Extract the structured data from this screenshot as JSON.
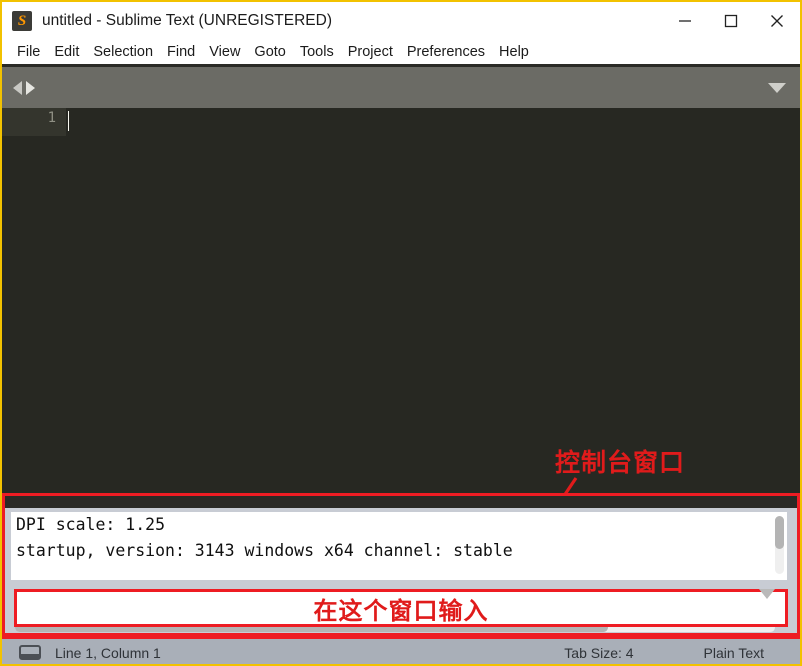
{
  "window": {
    "title": "untitled - Sublime Text (UNREGISTERED)",
    "icon": "sublime-text-icon",
    "icon_glyph": "S",
    "border_color": "#f2c200",
    "controls": {
      "minimize": "minimize-icon",
      "maximize": "maximize-icon",
      "close": "close-icon"
    }
  },
  "menubar": {
    "items": [
      {
        "label": "File"
      },
      {
        "label": "Edit"
      },
      {
        "label": "Selection"
      },
      {
        "label": "Find"
      },
      {
        "label": "View"
      },
      {
        "label": "Goto"
      },
      {
        "label": "Tools"
      },
      {
        "label": "Project"
      },
      {
        "label": "Preferences"
      },
      {
        "label": "Help"
      }
    ]
  },
  "tabbar": {
    "prev_icon": "arrow-left-icon",
    "next_icon": "arrow-right-icon",
    "menu_icon": "chevron-down-icon"
  },
  "editor": {
    "line_number": "1",
    "background": "#272822",
    "content": ""
  },
  "annotations": {
    "accent_color": "#e01b1b",
    "console_label": "控制台窗口",
    "arrow": "red-arrow-pointing-to-console",
    "input_label": "在这个窗口输入"
  },
  "console": {
    "lines": [
      "DPI scale: 1.25",
      "startup, version: 3143 windows x64 channel: stable",
      " "
    ],
    "vertical_scrollbar": "console-vertical-scrollbar",
    "horizontal_scrollbar": "console-horizontal-scrollbar",
    "input": {
      "value": "",
      "dropdown_icon": "chevron-down-icon"
    },
    "highlight_color": "#ee1c23"
  },
  "statusbar": {
    "icon": "panel-toggle-icon",
    "position": "Line 1, Column 1",
    "tab_size": "Tab Size: 4",
    "syntax": "Plain Text"
  }
}
